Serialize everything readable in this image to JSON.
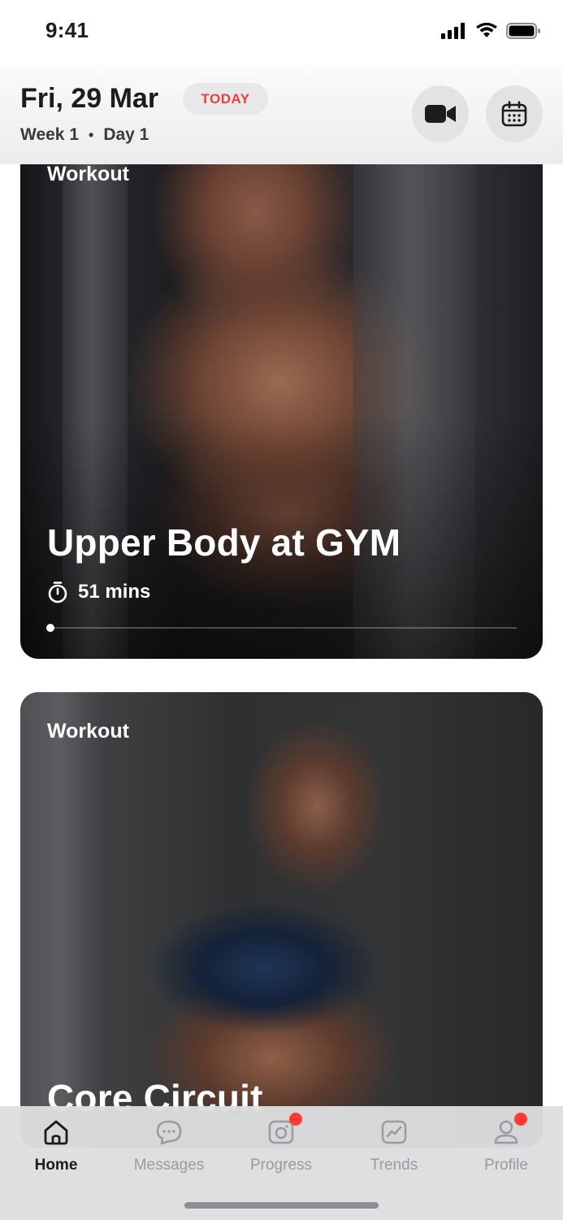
{
  "status_bar": {
    "time": "9:41"
  },
  "header": {
    "date": "Fri, 29 Mar",
    "today_badge": "TODAY",
    "week": "Week 1",
    "separator": "•",
    "day": "Day 1",
    "video_icon": "video-camera-icon",
    "calendar_icon": "calendar-icon"
  },
  "cards": [
    {
      "kicker": "Workout",
      "title": "Upper Body at GYM",
      "duration": "51 mins",
      "duration_icon": "stopwatch-icon"
    },
    {
      "kicker": "Workout",
      "title": "Core Circuit"
    }
  ],
  "tabbar": {
    "items": [
      {
        "label": "Home",
        "icon": "home-icon",
        "active": true
      },
      {
        "label": "Messages",
        "icon": "chat-icon"
      },
      {
        "label": "Progress",
        "icon": "camera-icon",
        "badge": true
      },
      {
        "label": "Trends",
        "icon": "trend-chart-icon"
      },
      {
        "label": "Profile",
        "icon": "person-icon",
        "badge": true
      }
    ]
  },
  "colors": {
    "accent_red": "#e8413a",
    "badge_red": "#ff3b30",
    "text_dark": "#1c1c1e",
    "inactive": "#9a9aa0"
  }
}
